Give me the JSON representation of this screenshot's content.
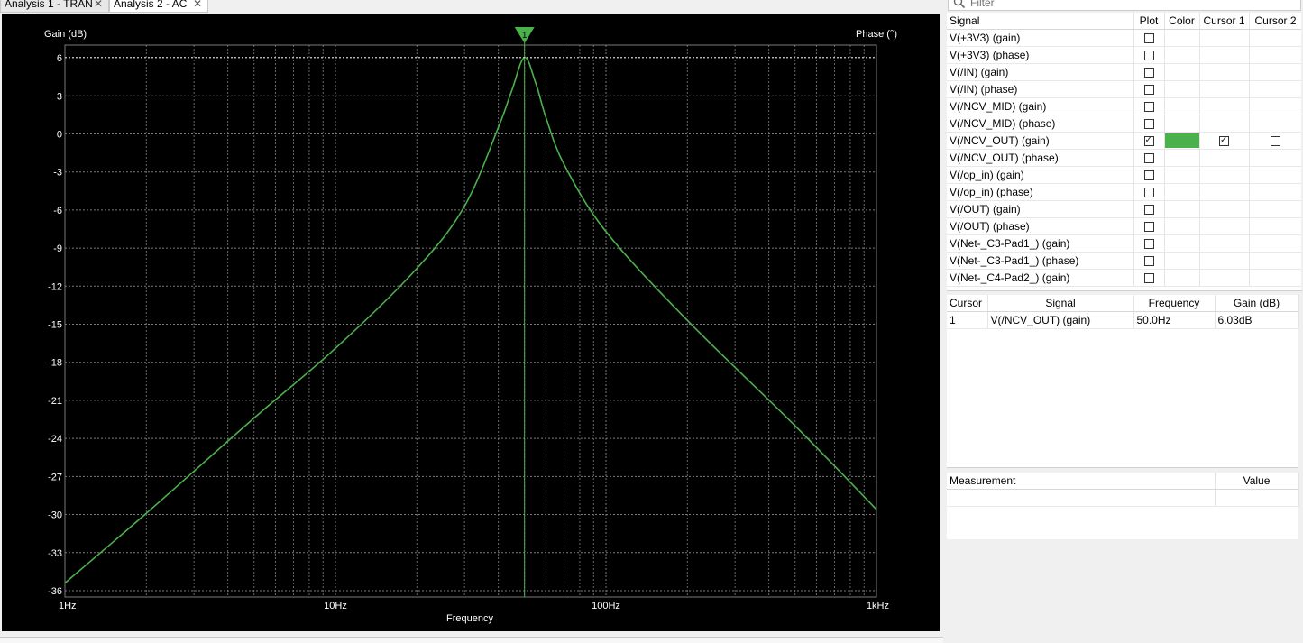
{
  "tabs": [
    {
      "label": "Analysis 1 - TRAN",
      "active": false
    },
    {
      "label": "Analysis 2 - AC",
      "active": true
    }
  ],
  "close_glyph": "✕",
  "filter": {
    "placeholder": "Filter",
    "icon": "search-icon"
  },
  "plot": {
    "background": "#000000",
    "grid_color": "#7a7a7a",
    "trace_color": "#4bb24b",
    "text_color": "#ffffff",
    "cursor_marker_label": "1"
  },
  "chart_data": {
    "type": "line",
    "xlabel": "Frequency",
    "ylabel": "Gain (dB)",
    "y2label": "Phase (°)",
    "x_scale": "log",
    "xlim": [
      1,
      1000
    ],
    "ylim": [
      -36.5,
      7
    ],
    "x_tick_labels": [
      "1Hz",
      "10Hz",
      "100Hz",
      "1kHz"
    ],
    "x_tick_values": [
      1,
      10,
      100,
      1000
    ],
    "y_ticks": [
      6,
      3,
      0,
      -3,
      -6,
      -9,
      -12,
      -15,
      -18,
      -21,
      -24,
      -27,
      -30,
      -33,
      -36
    ],
    "grid": true,
    "series": [
      {
        "name": "V(/NCV_OUT) (gain)",
        "color": "#4bb24b",
        "x": [
          1,
          2,
          5,
          10,
          20,
          30,
          40,
          45,
          50,
          55,
          60,
          70,
          100,
          200,
          500,
          1000
        ],
        "y": [
          -35.4,
          -29.9,
          -22.4,
          -16.9,
          -10.6,
          -5.7,
          0.5,
          3.5,
          6.03,
          4.0,
          1.3,
          -2.4,
          -7.7,
          -14.7,
          -23.0,
          -29.6
        ]
      }
    ],
    "cursor": {
      "id": "1",
      "x": 50.0
    }
  },
  "signals_table": {
    "headers": {
      "signal": "Signal",
      "plot": "Plot",
      "color": "Color",
      "cursor1": "Cursor 1",
      "cursor2": "Cursor 2"
    },
    "check_glyph": "✓",
    "rows": [
      {
        "signal": "V(+3V3) (gain)",
        "plot": false
      },
      {
        "signal": "V(+3V3) (phase)",
        "plot": false
      },
      {
        "signal": "V(/IN) (gain)",
        "plot": false
      },
      {
        "signal": "V(/IN) (phase)",
        "plot": false
      },
      {
        "signal": "V(/NCV_MID) (gain)",
        "plot": false
      },
      {
        "signal": "V(/NCV_MID) (phase)",
        "plot": false
      },
      {
        "signal": "V(/NCV_OUT) (gain)",
        "plot": true,
        "color": "#4bb24b",
        "cursor1": true,
        "cursor2": false
      },
      {
        "signal": "V(/NCV_OUT) (phase)",
        "plot": false
      },
      {
        "signal": "V(/op_in) (gain)",
        "plot": false
      },
      {
        "signal": "V(/op_in) (phase)",
        "plot": false
      },
      {
        "signal": "V(/OUT) (gain)",
        "plot": false
      },
      {
        "signal": "V(/OUT) (phase)",
        "plot": false
      },
      {
        "signal": "V(Net-_C3-Pad1_) (gain)",
        "plot": false
      },
      {
        "signal": "V(Net-_C3-Pad1_) (phase)",
        "plot": false
      },
      {
        "signal": "V(Net-_C4-Pad2_) (gain)",
        "plot": false
      }
    ]
  },
  "cursor_table": {
    "headers": {
      "cursor": "Cursor",
      "signal": "Signal",
      "frequency": "Frequency",
      "gain": "Gain (dB)"
    },
    "rows": [
      {
        "cursor": "1",
        "signal": "V(/NCV_OUT) (gain)",
        "frequency": "50.0Hz",
        "gain": "6.03dB"
      }
    ]
  },
  "measurement_table": {
    "headers": {
      "measurement": "Measurement",
      "value": "Value"
    }
  }
}
